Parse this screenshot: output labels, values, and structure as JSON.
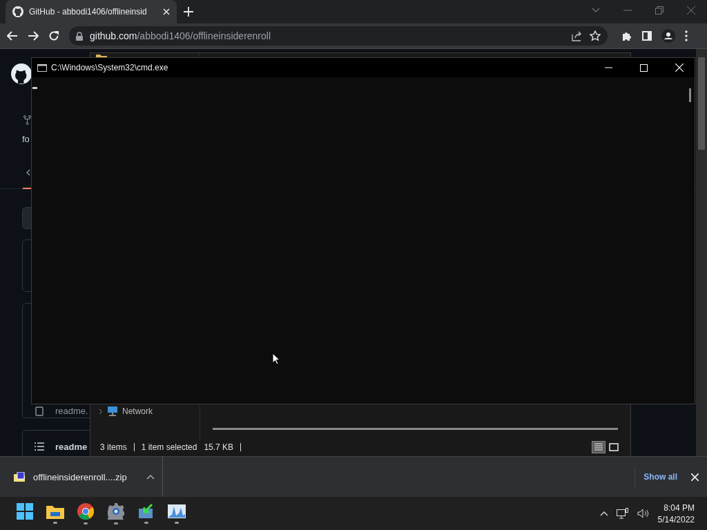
{
  "browser": {
    "tab": {
      "title": "GitHub - abbodi1406/offlineinsid"
    },
    "address": {
      "host": "github.com",
      "path": "/abbodi1406/offlineinsiderenroll"
    }
  },
  "github_page": {
    "fork_label": "fo",
    "file_row": "readme.",
    "readme_header": "readme"
  },
  "explorer": {
    "nav_items": [
      {
        "label": "Network"
      }
    ],
    "status": {
      "items": "3 items",
      "selection": "1 item selected",
      "size": "15.7 KB"
    },
    "views": [
      {
        "kind": "details",
        "selected": true
      },
      {
        "kind": "tiles",
        "selected": false
      }
    ]
  },
  "console": {
    "title": "C:\\Windows\\System32\\cmd.exe"
  },
  "download_bar": {
    "file": "offlineinsiderenroll....zip",
    "show_all": "Show all"
  },
  "taskbar": {
    "apps": [
      {
        "kind": "start",
        "running": false
      },
      {
        "kind": "explorer",
        "running": true
      },
      {
        "kind": "chrome",
        "running": true
      },
      {
        "kind": "settings",
        "running": true
      },
      {
        "kind": "installer",
        "running": true
      },
      {
        "kind": "monitor",
        "running": true
      }
    ],
    "time": "8:04 PM",
    "date": "5/14/2022"
  }
}
